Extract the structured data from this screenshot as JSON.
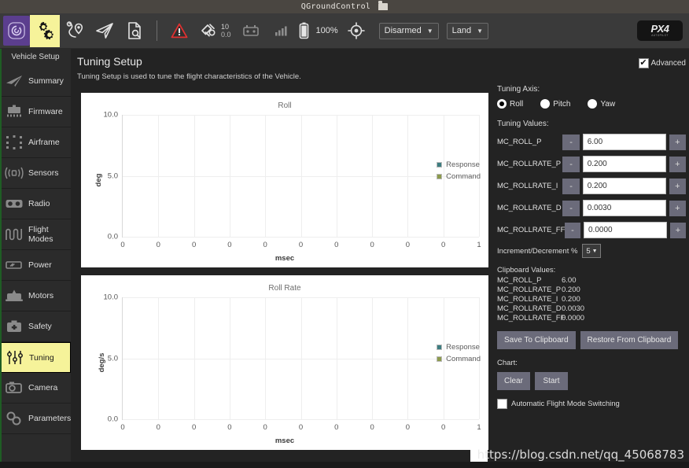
{
  "window": {
    "title": "QGroundControl",
    "title_icon": "folder-icon"
  },
  "toolbar": {
    "buttons": [
      {
        "name": "qgc-app-icon",
        "label": ""
      },
      {
        "name": "vehicle-setup-gears-icon",
        "label": ""
      },
      {
        "name": "plan-waypoints-icon",
        "label": ""
      },
      {
        "name": "fly-view-icon",
        "label": ""
      },
      {
        "name": "analyze-log-icon",
        "label": ""
      }
    ],
    "warning_icon": "warning-triangle-icon",
    "satellite": {
      "icon": "satellite-icon",
      "count": "10",
      "hdop": "0.0"
    },
    "rc_icon": "rc-transmitter-icon",
    "signal_icon": "signal-bars-icon",
    "battery": {
      "icon": "battery-icon",
      "percent": "100%"
    },
    "gps_icon": "gps-crosshair-icon",
    "armed_state": "Disarmed",
    "flight_mode": "Land",
    "logo": {
      "brand": "PX4",
      "tagline": "AUTOPILOT"
    }
  },
  "sidebar": {
    "title": "Vehicle Setup",
    "items": [
      {
        "label": "Summary",
        "icon": "plane-icon"
      },
      {
        "label": "Firmware",
        "icon": "firmware-chip-icon"
      },
      {
        "label": "Airframe",
        "icon": "airframe-icon"
      },
      {
        "label": "Sensors",
        "icon": "sensors-icon"
      },
      {
        "label": "Radio",
        "icon": "radio-icon"
      },
      {
        "label": "Flight Modes",
        "icon": "flight-modes-icon"
      },
      {
        "label": "Power",
        "icon": "power-icon"
      },
      {
        "label": "Motors",
        "icon": "motors-icon"
      },
      {
        "label": "Safety",
        "icon": "safety-icon"
      },
      {
        "label": "Tuning",
        "icon": "tuning-sliders-icon",
        "active": true
      },
      {
        "label": "Camera",
        "icon": "camera-icon"
      },
      {
        "label": "Parameters",
        "icon": "parameters-icon"
      }
    ]
  },
  "page": {
    "title": "Tuning Setup",
    "subtitle": "Tuning Setup is used to tune the flight characteristics of the Vehicle.",
    "advanced_label": "Advanced",
    "advanced_checked": true,
    "advanced_check_glyph": "✔"
  },
  "chart_data": [
    {
      "type": "line",
      "title": "Roll",
      "xlabel": "msec",
      "ylabel": "deg",
      "yticks": [
        "0.0",
        "5.0",
        "10.0"
      ],
      "ylim": [
        0,
        10
      ],
      "xticks": [
        "0",
        "0",
        "0",
        "0",
        "0",
        "0",
        "0",
        "0",
        "0",
        "0",
        "1"
      ],
      "grid": true,
      "legend_position": "right",
      "series": [
        {
          "name": "Response",
          "color": "#3d7d80",
          "values": []
        },
        {
          "name": "Command",
          "color": "#8c9a4c",
          "values": []
        }
      ]
    },
    {
      "type": "line",
      "title": "Roll Rate",
      "xlabel": "msec",
      "ylabel": "deg/s",
      "yticks": [
        "0.0",
        "5.0",
        "10.0"
      ],
      "ylim": [
        0,
        10
      ],
      "xticks": [
        "0",
        "0",
        "0",
        "0",
        "0",
        "0",
        "0",
        "0",
        "0",
        "0",
        "1"
      ],
      "grid": true,
      "legend_position": "right",
      "series": [
        {
          "name": "Response",
          "color": "#3d7d80",
          "values": []
        },
        {
          "name": "Command",
          "color": "#8c9a4c",
          "values": []
        }
      ]
    }
  ],
  "tuning": {
    "axis_label": "Tuning Axis:",
    "axes": [
      {
        "label": "Roll",
        "selected": true
      },
      {
        "label": "Pitch",
        "selected": false
      },
      {
        "label": "Yaw",
        "selected": false
      }
    ],
    "values_label": "Tuning Values:",
    "decrement_label": "-",
    "increment_label": "+",
    "values": [
      {
        "name": "MC_ROLL_P",
        "value": "6.00"
      },
      {
        "name": "MC_ROLLRATE_P",
        "value": "0.200"
      },
      {
        "name": "MC_ROLLRATE_I",
        "value": "0.200"
      },
      {
        "name": "MC_ROLLRATE_D",
        "value": "0.0030"
      },
      {
        "name": "MC_ROLLRATE_FF",
        "value": "0.0000"
      }
    ],
    "increment_label_text": "Increment/Decrement %",
    "increment_value": "5",
    "clipboard_title": "Clipboard Values:",
    "clipboard": [
      {
        "name": "MC_ROLL_P",
        "value": "6.00"
      },
      {
        "name": "MC_ROLLRATE_P",
        "value": "0.200"
      },
      {
        "name": "MC_ROLLRATE_I",
        "value": "0.200"
      },
      {
        "name": "MC_ROLLRATE_D",
        "value": "0.0030"
      },
      {
        "name": "MC_ROLLRATE_FF",
        "value": "0.0000"
      }
    ],
    "save_clipboard_label": "Save To Clipboard",
    "restore_clipboard_label": "Restore From Clipboard",
    "chart_section_label": "Chart:",
    "clear_label": "Clear",
    "start_label": "Start",
    "auto_switch_label": "Automatic Flight Mode Switching",
    "auto_switch_checked": false
  },
  "watermark": {
    "text": "https://blog.csdn.net/qq_45068783"
  },
  "colors": {
    "accent_yellow": "#f6f39a",
    "toolbar_bg": "#3a3a3a",
    "sidebar_bg": "#2b2b2b",
    "content_bg": "#232323",
    "response": "#3d7d80",
    "command": "#8c9a4c"
  }
}
